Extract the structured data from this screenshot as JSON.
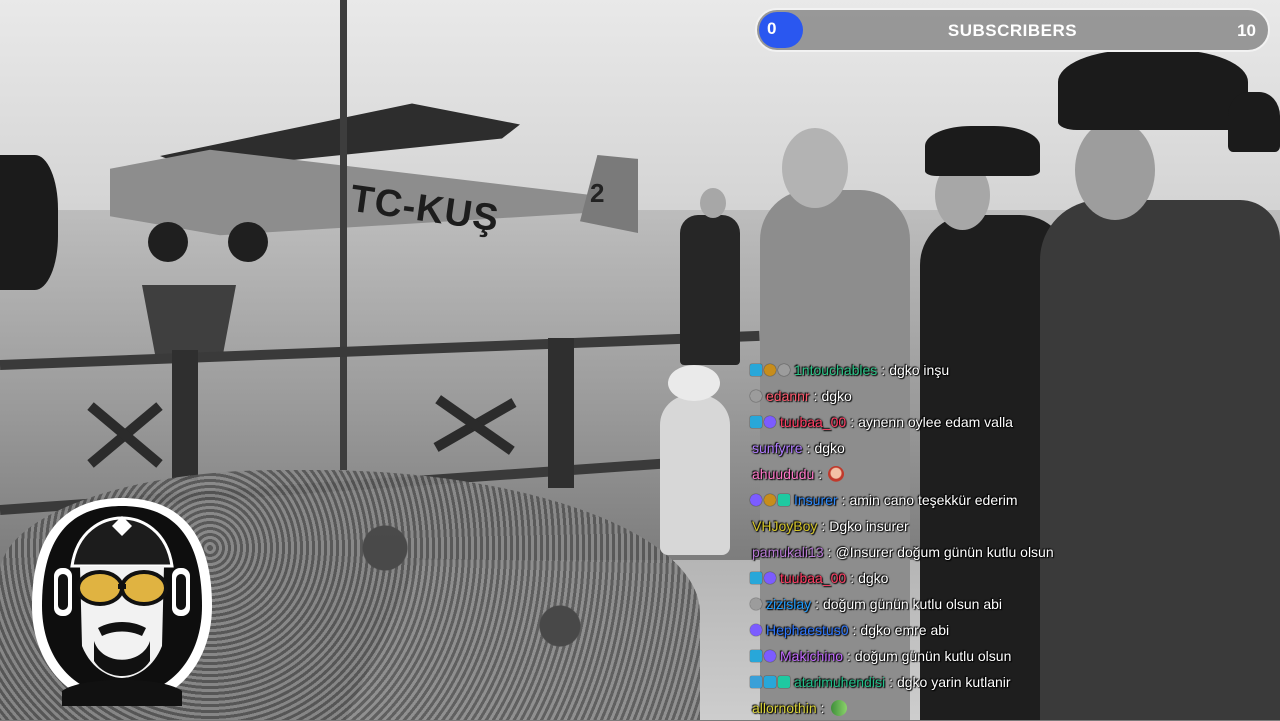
{
  "colors": {
    "progress": "#2a57f0",
    "subscriber_badge": "#1aa6d6",
    "mod_badge": "#22a36a"
  },
  "background": {
    "plane_registration": "TC-KUŞ",
    "plane_tail_number": "2"
  },
  "subscriber_goal": {
    "current": "0",
    "label": "SUBSCRIBERS",
    "goal": "10",
    "progress_fraction": 0.0
  },
  "chat": {
    "messages": [
      {
        "badges": [
          "subscriber-icon",
          "gift-icon",
          "bits-icon"
        ],
        "user": "1ntouchables",
        "color": "#2fc58a",
        "text": "dgko inşu"
      },
      {
        "badges": [
          "bits-icon"
        ],
        "user": "edannr",
        "color": "#ff5b6f",
        "text": "dgko"
      },
      {
        "badges": [
          "subscriber-icon",
          "prime-icon"
        ],
        "user": "tuubaa_00",
        "color": "#ff3d63",
        "text": "aynenn oylee edam valla"
      },
      {
        "badges": [],
        "user": "sunfyrre",
        "color": "#b07cff",
        "text": "dgko"
      },
      {
        "badges": [],
        "user": "ahuududu",
        "color": "#ff78c8",
        "text": "",
        "emote": "girl-emote"
      },
      {
        "badges": [
          "prime-icon",
          "gift-icon",
          "vip-icon"
        ],
        "user": "Insurer",
        "color": "#2e8bff",
        "text": "amin cano teşekkür ederim"
      },
      {
        "badges": [],
        "user": "VHJoyBoy",
        "color": "#d4c52a",
        "text": "Dgko insurer"
      },
      {
        "badges": [],
        "user": "pamukali13",
        "color": "#b77ad3",
        "text": "@Insurer doğum günün kutlu olsun"
      },
      {
        "badges": [
          "subscriber-icon",
          "prime-icon"
        ],
        "user": "tuubaa_00",
        "color": "#ff3d63",
        "text": "dgko"
      },
      {
        "badges": [
          "bits-icon"
        ],
        "user": "zizislay",
        "color": "#1e9cff",
        "text": "doğum günün kutlu olsun abi"
      },
      {
        "badges": [
          "prime-icon"
        ],
        "user": "Hephaestus0",
        "color": "#2f78ff",
        "text": "dgko emre abi"
      },
      {
        "badges": [
          "subscriber-icon",
          "prime-icon"
        ],
        "user": "Makichino",
        "color": "#c36bff",
        "text": "doğum günün kutlu olsun"
      },
      {
        "badges": [
          "mod-icon",
          "subscriber-icon",
          "vip-icon"
        ],
        "user": "atarimuhendisi",
        "color": "#22c08a",
        "text": "dgko yarin kutlanir"
      },
      {
        "badges": [],
        "user": "allornothin",
        "color": "#d9d23a",
        "text": "",
        "emote": "croc-emote"
      }
    ]
  }
}
